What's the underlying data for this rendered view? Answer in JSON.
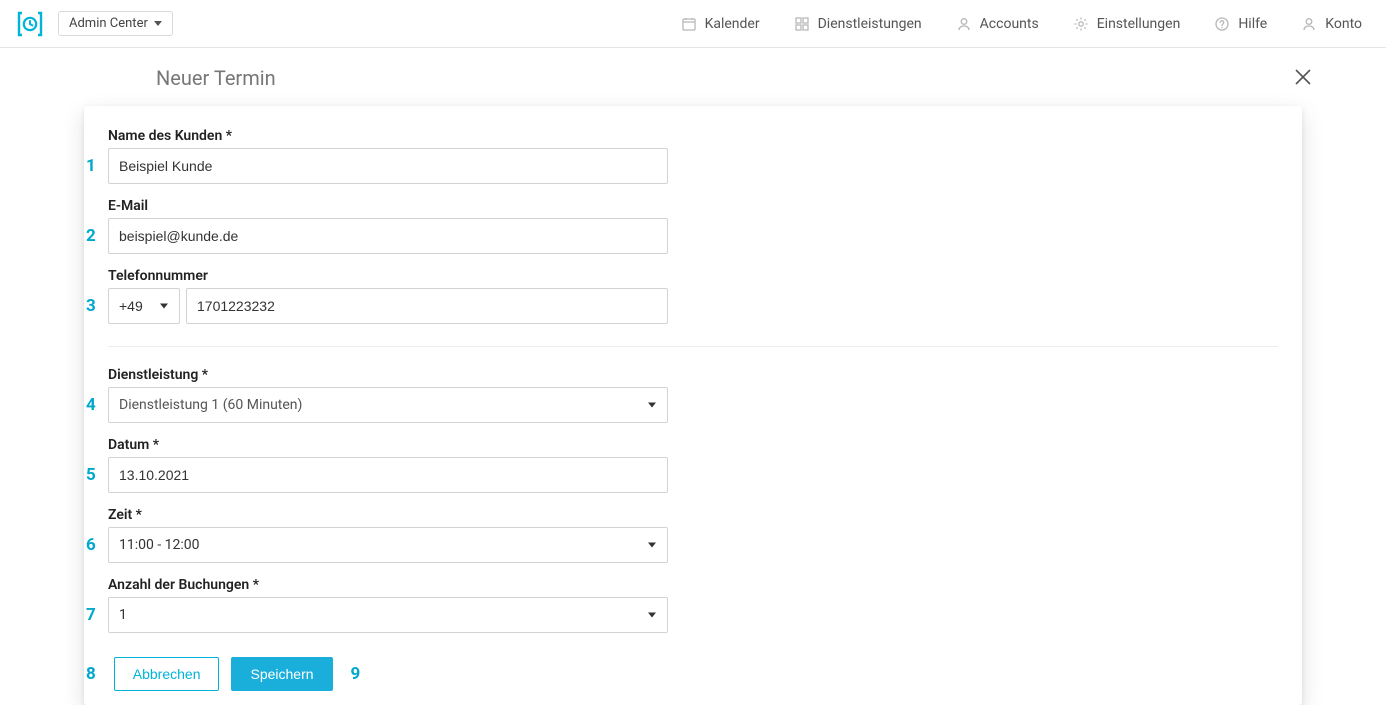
{
  "topbar": {
    "admin_center_label": "Admin Center",
    "nav": {
      "calendar": "Kalender",
      "services": "Dienstleistungen",
      "accounts": "Accounts",
      "settings": "Einstellungen",
      "help": "Hilfe",
      "account": "Konto"
    }
  },
  "page": {
    "title": "Neuer Termin"
  },
  "form": {
    "customer_name": {
      "label": "Name des Kunden *",
      "value": "Beispiel Kunde"
    },
    "email": {
      "label": "E-Mail",
      "value": "beispiel@kunde.de"
    },
    "phone": {
      "label": "Telefonnummer",
      "prefix": "+49",
      "value": "1701223232"
    },
    "service": {
      "label": "Dienstleistung *",
      "value": "Dienstleistung 1 (60 Minuten)"
    },
    "date": {
      "label": "Datum *",
      "value": "13.10.2021"
    },
    "time": {
      "label": "Zeit *",
      "value": "11:00 - 12:00"
    },
    "bookings": {
      "label": "Anzahl der Buchungen *",
      "value": "1"
    },
    "actions": {
      "cancel": "Abbrechen",
      "save": "Speichern"
    }
  },
  "annotations": {
    "n1": "1",
    "n2": "2",
    "n3": "3",
    "n4": "4",
    "n5": "5",
    "n6": "6",
    "n7": "7",
    "n8": "8",
    "n9": "9"
  }
}
